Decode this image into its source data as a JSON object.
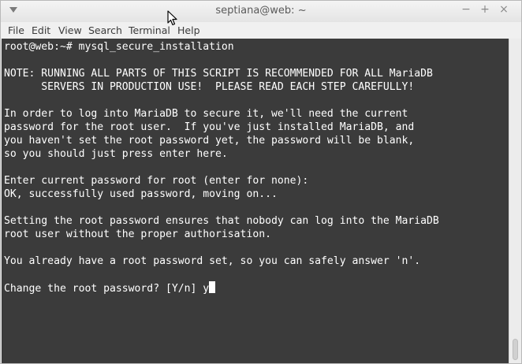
{
  "window": {
    "title": "septiana@web: ~",
    "controls": {
      "minimize": "−",
      "maximize": "+",
      "close": "×"
    }
  },
  "menubar": {
    "items": [
      "File",
      "Edit",
      "View",
      "Search",
      "Terminal",
      "Help"
    ]
  },
  "terminal": {
    "lines": [
      "root@web:~# mysql_secure_installation",
      "",
      "NOTE: RUNNING ALL PARTS OF THIS SCRIPT IS RECOMMENDED FOR ALL MariaDB",
      "      SERVERS IN PRODUCTION USE!  PLEASE READ EACH STEP CAREFULLY!",
      "",
      "In order to log into MariaDB to secure it, we'll need the current",
      "password for the root user.  If you've just installed MariaDB, and",
      "you haven't set the root password yet, the password will be blank,",
      "so you should just press enter here.",
      "",
      "Enter current password for root (enter for none):",
      "OK, successfully used password, moving on...",
      "",
      "Setting the root password ensures that nobody can log into the MariaDB",
      "root user without the proper authorisation.",
      "",
      "You already have a root password set, so you can safely answer 'n'.",
      "",
      "Change the root password? [Y/n] y"
    ]
  },
  "colors": {
    "terminal_bg": "#3b3b3b",
    "terminal_fg": "#ffffff"
  },
  "icons": {
    "window_menu": "triangle-down-icon",
    "pointer": "mouse-pointer-icon"
  }
}
